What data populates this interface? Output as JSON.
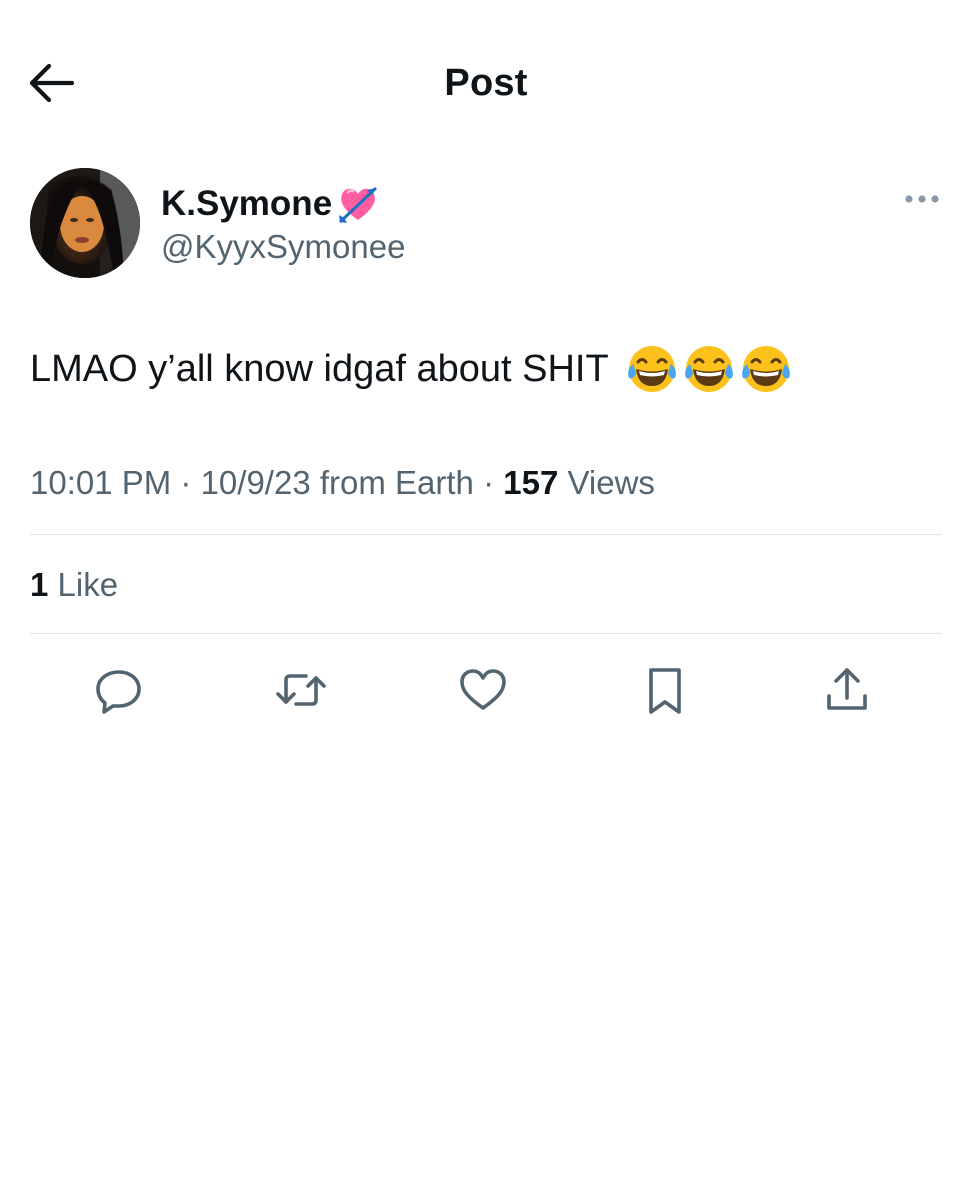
{
  "header": {
    "title": "Post",
    "back_icon": "arrow-left-icon"
  },
  "author": {
    "display_name": "K.Symone",
    "name_emoji": "heart-with-arrow-emoji",
    "handle": "@KyyxSymonee",
    "more_icon": "more-horizontal-icon"
  },
  "tweet": {
    "text": "LMAO y’all know idgaf about SHIT",
    "emojis": [
      "face-with-tears-of-joy-emoji",
      "face-with-tears-of-joy-emoji",
      "face-with-tears-of-joy-emoji"
    ]
  },
  "meta": {
    "time": "10:01 PM",
    "separator": " · ",
    "date": "10/9/23",
    "source": " from Earth",
    "views_separator": " · ",
    "views_count": "157",
    "views_label": " Views"
  },
  "engagement": {
    "likes_count": "1",
    "likes_label": " Like"
  },
  "actions": [
    {
      "name": "reply",
      "icon": "reply-icon"
    },
    {
      "name": "repost",
      "icon": "repost-icon"
    },
    {
      "name": "like",
      "icon": "heart-icon"
    },
    {
      "name": "bookmark",
      "icon": "bookmark-icon"
    },
    {
      "name": "share",
      "icon": "share-icon"
    }
  ],
  "colors": {
    "text_primary": "#0f1419",
    "text_secondary": "#536471",
    "divider": "#dfe3e6",
    "icon": "#536471"
  }
}
